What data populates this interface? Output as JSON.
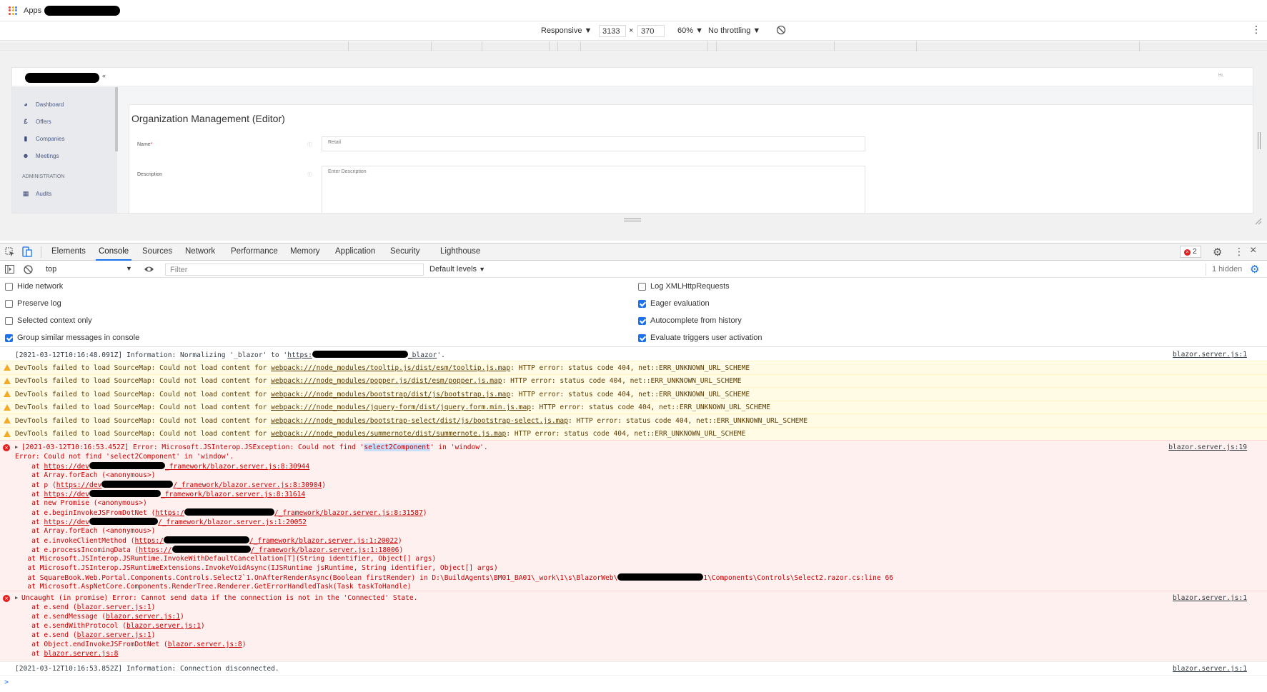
{
  "bookmarks": {
    "apps_label": "Apps"
  },
  "device_toolbar": {
    "device": "Responsive",
    "width": "3133",
    "height": "370",
    "times": "×",
    "zoom": "60%",
    "throttle": "No throttling"
  },
  "site": {
    "header_arrow": "«",
    "header_right": "Hi,",
    "sidebar": [
      {
        "label": "Dashboard",
        "icon": "dashboard-icon"
      },
      {
        "label": "Offers",
        "icon": "pound-icon"
      },
      {
        "label": "Companies",
        "icon": "building-icon"
      },
      {
        "label": "Meetings",
        "icon": "meetings-icon"
      }
    ],
    "admin_heading": "ADMINISTRATION",
    "admin_items": [
      {
        "label": "Audits",
        "icon": "grid-icon"
      }
    ],
    "page_title": "Organization Management (Editor)",
    "name_label": "Name",
    "name_required": "*",
    "name_value": "Retail",
    "description_label": "Description",
    "description_placeholder": "Enter Description"
  },
  "devtools": {
    "tabs": [
      "Elements",
      "Console",
      "Sources",
      "Network",
      "Performance",
      "Memory",
      "Application",
      "Security",
      "Lighthouse"
    ],
    "active_tab": "Console",
    "error_count": "2",
    "context": "top",
    "filter_placeholder": "Filter",
    "levels": "Default levels",
    "hidden": "1 hidden",
    "settings_left": [
      {
        "label": "Hide network",
        "checked": false
      },
      {
        "label": "Preserve log",
        "checked": false
      },
      {
        "label": "Selected context only",
        "checked": false
      },
      {
        "label": "Group similar messages in console",
        "checked": true
      }
    ],
    "settings_right": [
      {
        "label": "Log XMLHttpRequests",
        "checked": false
      },
      {
        "label": "Eager evaluation",
        "checked": true
      },
      {
        "label": "Autocomplete from history",
        "checked": true
      },
      {
        "label": "Evaluate triggers user activation",
        "checked": true
      }
    ]
  },
  "console": {
    "info1": {
      "pre": "[2021-03-12T10:16:48.091Z] Information: Normalizing '_blazor' to '",
      "link_a": "https:",
      "link_b": "_blazor",
      "post": "'.",
      "source": "blazor.server.js:1"
    },
    "warn_prefix": "DevTools failed to load SourceMap: Could not load content for ",
    "warnings": [
      {
        "url": "webpack:///node_modules/tooltip.js/dist/esm/tooltip.js.map",
        "suffix": ": HTTP error: status code 404, net::ERR_UNKNOWN_URL_SCHEME"
      },
      {
        "url": "webpack:///node_modules/popper.js/dist/esm/popper.js.map",
        "suffix": ": HTTP error: status code 404, net::ERR_UNKNOWN_URL_SCHEME"
      },
      {
        "url": "webpack:///node_modules/bootstrap/dist/js/bootstrap.js.map",
        "suffix": ": HTTP error: status code 404, net::ERR_UNKNOWN_URL_SCHEME"
      },
      {
        "url": "webpack:///node_modules/jquery-form/dist/jquery.form.min.js.map",
        "suffix": ": HTTP error: status code 404, net::ERR_UNKNOWN_URL_SCHEME"
      },
      {
        "url": "webpack:///node_modules/bootstrap-select/dist/js/bootstrap-select.js.map",
        "suffix": ": HTTP error: status code 404, net::ERR_UNKNOWN_URL_SCHEME"
      },
      {
        "url": "webpack:///node_modules/summernote/dist/summernote.js.map",
        "suffix": ": HTTP error: status code 404, net::ERR_UNKNOWN_URL_SCHEME"
      }
    ],
    "error1": {
      "head_pre": "[2021-03-12T10:16:53.452Z] Error: Microsoft.JSInterop.JSException: Could not find '",
      "head_hl": "select2Component",
      "head_post": "' in 'window'.",
      "line2": "Error: Could not find 'select2Component' in 'window'.",
      "source": "blazor.server.js:19",
      "s1a": "    at ",
      "s1b": "https://dev",
      "s1c": "_framework/blazor.server.js:8:30944",
      "s2": "    at Array.forEach (<anonymous>)",
      "s3a": "    at p (",
      "s3b": "https://dev",
      "s3c": "/_framework/blazor.server.js:8:30904",
      "s3d": ")",
      "s4a": "    at ",
      "s4b": "https://dev",
      "s4c": "_framework/blazor.server.js:8:31614",
      "s5": "    at new Promise (<anonymous>)",
      "s6a": "    at e.beginInvokeJSFromDotNet (",
      "s6b": "https:/",
      "s6c": "/_framework/blazor.server.js:8:31587",
      "s6d": ")",
      "s7a": "    at ",
      "s7b": "https://dev",
      "s7c": "/_framework/blazor.server.js:1:20052",
      "s8": "    at Array.forEach (<anonymous>)",
      "s9a": "    at e.invokeClientMethod (",
      "s9b": "https:/",
      "s9c": "/_framework/blazor.server.js:1:20022",
      "s9d": ")",
      "s10a": "    at e.processIncomingData (",
      "s10b": "https://",
      "s10c": "/_framework/blazor.server.js:1:18006",
      "s10d": ")",
      "s11": "   at Microsoft.JSInterop.JSRuntime.InvokeWithDefaultCancellation[T](String identifier, Object[] args)",
      "s12": "   at Microsoft.JSInterop.JSRuntimeExtensions.InvokeVoidAsync(IJSRuntime jsRuntime, String identifier, Object[] args)",
      "s13a": "   at SquareBook.Web.Portal.Components.Controls.Select2`1.OnAfterRenderAsync(Boolean firstRender) in D:\\BuildAgents\\BM01_BA01\\_work\\1\\s\\BlazorWeb\\",
      "s13b": "1\\Components\\Controls\\Select2.razor.cs:line 66",
      "s14": "   at Microsoft.AspNetCore.Components.RenderTree.Renderer.GetErrorHandledTask(Task taskToHandle)"
    },
    "error2": {
      "head": "Uncaught (in promise) Error: Cannot send data if the connection is not in the 'Connected' State.",
      "source": "blazor.server.js:1",
      "stack": [
        {
          "pre": "    at e.send (",
          "link": "blazor.server.js:1",
          "post": ")"
        },
        {
          "pre": "    at e.sendMessage (",
          "link": "blazor.server.js:1",
          "post": ")"
        },
        {
          "pre": "    at e.sendWithProtocol (",
          "link": "blazor.server.js:1",
          "post": ")"
        },
        {
          "pre": "    at e.send (",
          "link": "blazor.server.js:1",
          "post": ")"
        },
        {
          "pre": "    at Object.endInvokeJSFromDotNet (",
          "link": "blazor.server.js:8",
          "post": ")"
        },
        {
          "pre": "    at ",
          "link": "blazor.server.js:8",
          "post": ""
        }
      ]
    },
    "info2": {
      "text": "[2021-03-12T10:16:53.852Z] Information: Connection disconnected.",
      "source": "blazor.server.js:1"
    },
    "prompt": ">"
  },
  "colors": {
    "warning_bg": "#fffbe5",
    "error_bg": "#fff0f0",
    "error_text": "#c80000",
    "accent": "#1a73e8"
  }
}
